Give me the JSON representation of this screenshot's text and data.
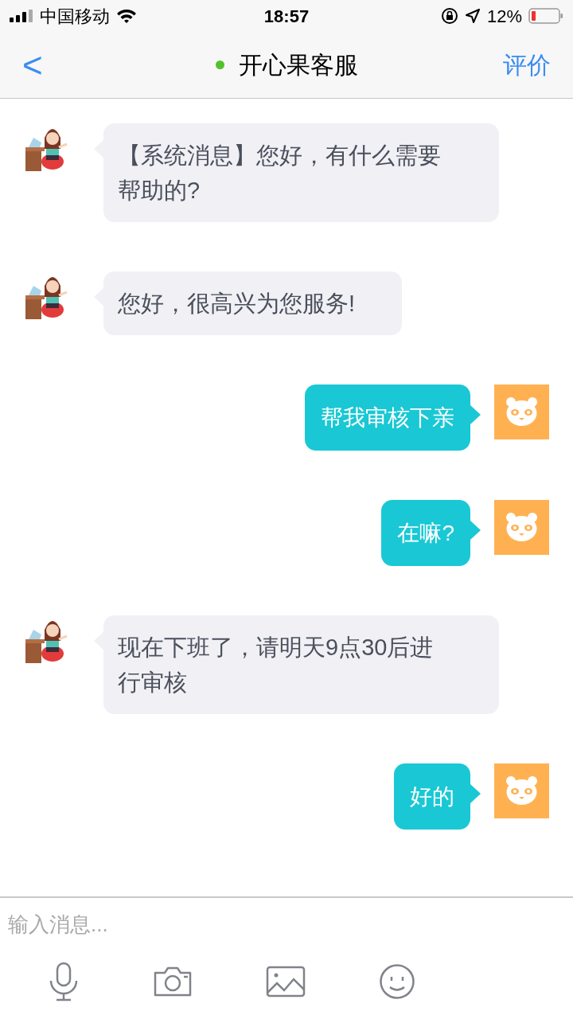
{
  "status_bar": {
    "carrier": "中国移动",
    "time": "18:57",
    "battery": "12%"
  },
  "nav": {
    "back": "<",
    "title": "开心果客服",
    "online": true,
    "action": "评价"
  },
  "messages": [
    {
      "kind": "incoming",
      "text": "【系统消息】您好，有什么需要帮助的?"
    },
    {
      "kind": "incoming",
      "text": "您好，很高兴为您服务!"
    },
    {
      "kind": "outgoing",
      "text": "帮我审核下亲"
    },
    {
      "kind": "outgoing",
      "text": "在嘛?"
    },
    {
      "kind": "incoming",
      "text": "现在下班了，请明天9点30后进行审核"
    },
    {
      "kind": "outgoing",
      "text": "好的"
    }
  ],
  "composer": {
    "placeholder": "输入消息..."
  }
}
